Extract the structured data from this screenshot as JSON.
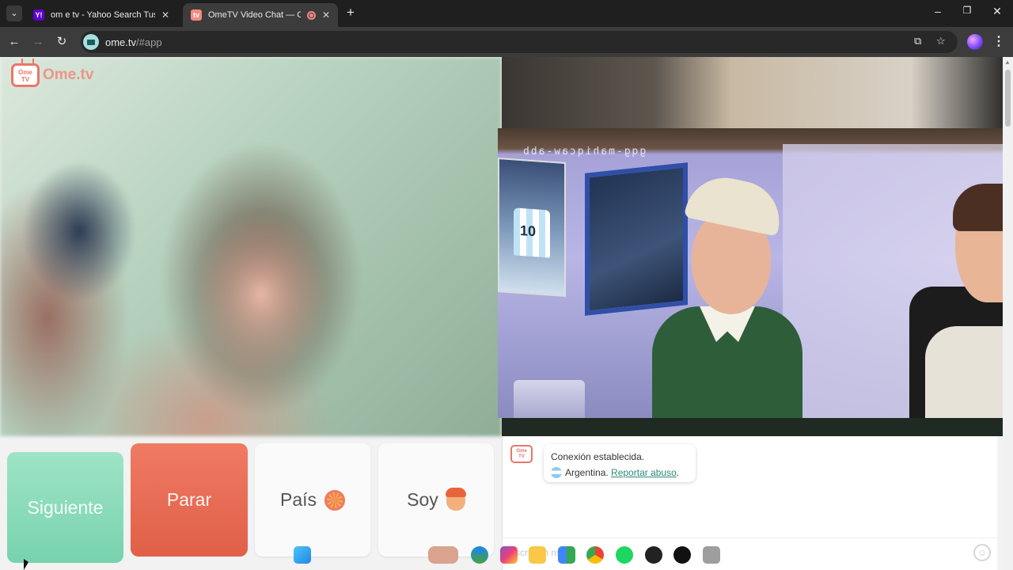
{
  "browser": {
    "tabs": [
      {
        "title": "om e tv - Yahoo Search Tus res",
        "favicon": "Y!",
        "favicon_color": "#5f01d1",
        "active": false
      },
      {
        "title": "OmeTV Video Chat — Ome",
        "favicon": "tv",
        "favicon_color": "#f28b82",
        "active": true
      }
    ],
    "new_tab_icon": "plus-icon",
    "url_host": "ome.tv",
    "url_path": "/#app"
  },
  "site": {
    "logo_text": "Ome.tv",
    "logo_badge_line1": "Ome",
    "logo_badge_line2": "TV"
  },
  "partner_video": {
    "mirrored_watermark": "gqg-mahiqcaw-abb"
  },
  "controls": {
    "next_label": "Siguiente",
    "stop_label": "Parar",
    "country_label": "País",
    "gender_label": "Soy"
  },
  "chat": {
    "badge_line1": "Ome",
    "badge_line2": "TV",
    "status_text": "Conexión establecida.",
    "country_text": "Argentina.",
    "report_link": "Reportar abuso",
    "report_suffix": ".",
    "input_placeholder": "scrib un nsa"
  },
  "colors": {
    "next": "#78d2ae",
    "stop": "#e15f48",
    "accent": "#e8776a",
    "link": "#2b8a7a"
  }
}
